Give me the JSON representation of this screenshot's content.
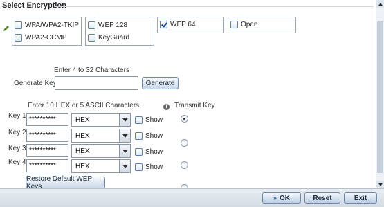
{
  "section": {
    "title": "Select Encryption"
  },
  "encryption": {
    "options": [
      {
        "label": "WPA/WPA2-TKIP",
        "checked": false
      },
      {
        "label": "WPA2-CCMP",
        "checked": false
      },
      {
        "label": "WEP 128",
        "checked": false
      },
      {
        "label": "KeyGuard",
        "checked": false
      },
      {
        "label": "WEP 64",
        "checked": true
      },
      {
        "label": "Open",
        "checked": false
      }
    ]
  },
  "generate": {
    "hint": "Enter 4 to 32 Characters",
    "label": "Generate Keys",
    "value": "",
    "button": "Generate"
  },
  "keys": {
    "hint": "Enter 10 HEX or 5 ASCII Characters",
    "transmit_label": "Transmit Key",
    "show_label": "Show",
    "rows": [
      {
        "label": "Key 1",
        "value": "**********",
        "format": "HEX",
        "transmit": true
      },
      {
        "label": "Key 2",
        "value": "**********",
        "format": "HEX",
        "transmit": false
      },
      {
        "label": "Key 3",
        "value": "**********",
        "format": "HEX",
        "transmit": false
      },
      {
        "label": "Key 4",
        "value": "**********",
        "format": "HEX",
        "transmit": false
      }
    ],
    "restore_button": "Restore Default WEP Keys"
  },
  "footer": {
    "ok": "OK",
    "reset": "Reset",
    "exit": "Exit"
  },
  "icons": {
    "edit": "pencil-icon",
    "info": "info-icon",
    "ok": "double-arrow-icon"
  },
  "colors": {
    "accent": "#1e5aa8",
    "pencil": "#4f8a2c"
  }
}
